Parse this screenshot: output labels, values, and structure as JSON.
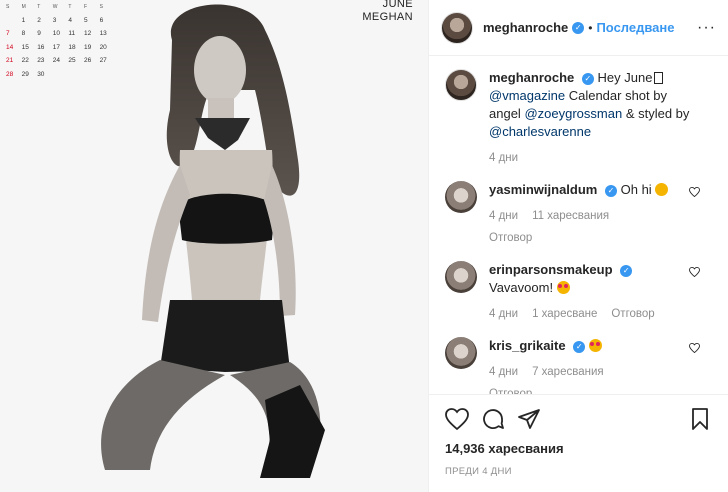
{
  "calendar": {
    "month": "JUNE",
    "name": "MEGHAN",
    "weekdays": [
      "S",
      "M",
      "T",
      "W",
      "T",
      "F",
      "S"
    ],
    "weeks": [
      [
        "",
        "1",
        "2",
        "3",
        "4",
        "5",
        "6"
      ],
      [
        "7",
        "8",
        "9",
        "10",
        "11",
        "12",
        "13"
      ],
      [
        "14",
        "15",
        "16",
        "17",
        "18",
        "19",
        "20"
      ],
      [
        "21",
        "22",
        "23",
        "24",
        "25",
        "26",
        "27"
      ],
      [
        "28",
        "29",
        "30",
        "",
        "",
        "",
        ""
      ]
    ]
  },
  "header": {
    "username": "meghanroche",
    "follow_label": "Последване",
    "more_icon": "ellipsis-icon"
  },
  "caption": {
    "username": "meghanroche",
    "text_1": "Hey June",
    "mention_1": "@vmagazine",
    "text_2": "Calendar shot by angel",
    "mention_2": "@zoeygrossman",
    "text_3": "& styled by",
    "mention_3": "@charlesvarenne",
    "time": "4 дни"
  },
  "comments": [
    {
      "username": "yasminwijnaldum",
      "text": "Oh hi",
      "time": "4 дни",
      "likes": "11 харесвания",
      "reply": "",
      "replies_toggle": "Отговор"
    },
    {
      "username": "erinparsonsmakeup",
      "text": "Vavavoom!",
      "time": "4 дни",
      "likes": "1 харесване",
      "reply": "Отговор",
      "replies_toggle": ""
    },
    {
      "username": "kris_grikaite",
      "text": "",
      "time": "4 дни",
      "likes": "7 харесвания",
      "reply": "",
      "replies_toggle": "Отговор"
    }
  ],
  "footer": {
    "likes": "14,936 харесвания",
    "posted": "ПРЕДИ 4 ДНИ"
  },
  "colors": {
    "link": "#3897f0",
    "verified": "#3897f0",
    "muted": "#8e8e8e",
    "mention": "#00376b"
  }
}
